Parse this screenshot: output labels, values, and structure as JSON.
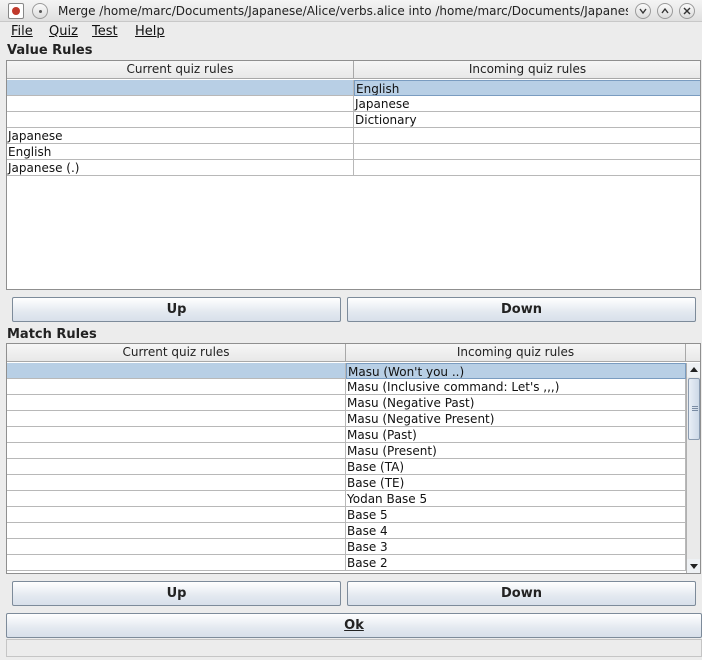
{
  "window": {
    "title": "Merge /home/marc/Documents/Japanese/Alice/verbs.alice into /home/marc/Documents/Japanese/..."
  },
  "menubar": {
    "items": [
      {
        "label": "File"
      },
      {
        "label": "Quiz"
      },
      {
        "label": "Test"
      },
      {
        "label": "Help"
      }
    ]
  },
  "value_rules": {
    "label": "Value Rules",
    "headers": {
      "current": "Current quiz rules",
      "incoming": "Incoming quiz rules"
    },
    "rows": [
      {
        "current": "",
        "incoming": "English",
        "selected": true
      },
      {
        "current": "",
        "incoming": "Japanese",
        "selected": false
      },
      {
        "current": "",
        "incoming": "Dictionary",
        "selected": false
      },
      {
        "current": "Japanese",
        "incoming": "",
        "selected": false
      },
      {
        "current": "English",
        "incoming": "",
        "selected": false
      },
      {
        "current": "Japanese (.)",
        "incoming": "",
        "selected": false
      }
    ],
    "up_label": "Up",
    "down_label": "Down"
  },
  "match_rules": {
    "label": "Match Rules",
    "headers": {
      "current": "Current quiz rules",
      "incoming": "Incoming quiz rules"
    },
    "rows": [
      {
        "current": "",
        "incoming": "Masu (Won't you ..)",
        "selected": true
      },
      {
        "current": "",
        "incoming": "Masu (Inclusive command: Let's ,,,)",
        "selected": false
      },
      {
        "current": "",
        "incoming": "Masu (Negative Past)",
        "selected": false
      },
      {
        "current": "",
        "incoming": "Masu (Negative Present)",
        "selected": false
      },
      {
        "current": "",
        "incoming": "Masu (Past)",
        "selected": false
      },
      {
        "current": "",
        "incoming": "Masu (Present)",
        "selected": false
      },
      {
        "current": "",
        "incoming": "Base (TA)",
        "selected": false
      },
      {
        "current": "",
        "incoming": "Base (TE)",
        "selected": false
      },
      {
        "current": "",
        "incoming": "Yodan Base 5",
        "selected": false
      },
      {
        "current": "",
        "incoming": "Base 5",
        "selected": false
      },
      {
        "current": "",
        "incoming": "Base 4",
        "selected": false
      },
      {
        "current": "",
        "incoming": "Base 3",
        "selected": false
      },
      {
        "current": "",
        "incoming": "Base 2",
        "selected": false
      }
    ],
    "scroll_position": 0.0,
    "up_label": "Up",
    "down_label": "Down"
  },
  "ok_label": "Ok",
  "colors": {
    "selection": "#b8cfe5",
    "button_border": "#7d8b9a"
  }
}
